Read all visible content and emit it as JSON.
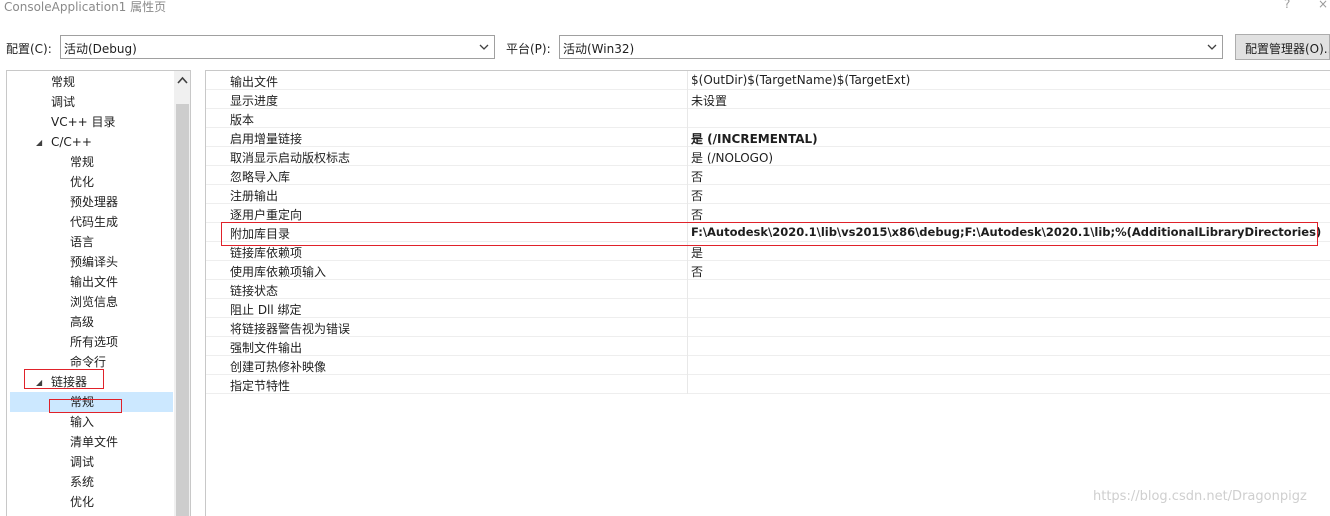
{
  "window": {
    "title": "ConsoleApplication1 属性页",
    "help_glyph": "?",
    "close_glyph": "×"
  },
  "toolbar": {
    "config_label": "配置(C):",
    "config_value": "活动(Debug)",
    "platform_label": "平台(P):",
    "platform_value": "活动(Win32)",
    "config_manager_label": "配置管理器(O)..."
  },
  "tree": {
    "items": [
      {
        "label": "常规",
        "level": 1
      },
      {
        "label": "调试",
        "level": 1
      },
      {
        "label": "VC++ 目录",
        "level": 1
      },
      {
        "label": "C/C++",
        "level": 1,
        "expanded": true
      },
      {
        "label": "常规",
        "level": 2
      },
      {
        "label": "优化",
        "level": 2
      },
      {
        "label": "预处理器",
        "level": 2
      },
      {
        "label": "代码生成",
        "level": 2
      },
      {
        "label": "语言",
        "level": 2
      },
      {
        "label": "预编译头",
        "level": 2
      },
      {
        "label": "输出文件",
        "level": 2
      },
      {
        "label": "浏览信息",
        "level": 2
      },
      {
        "label": "高级",
        "level": 2
      },
      {
        "label": "所有选项",
        "level": 2
      },
      {
        "label": "命令行",
        "level": 2
      },
      {
        "label": "链接器",
        "level": 1,
        "expanded": true
      },
      {
        "label": "常规",
        "level": 2,
        "selected": true
      },
      {
        "label": "输入",
        "level": 2
      },
      {
        "label": "清单文件",
        "level": 2
      },
      {
        "label": "调试",
        "level": 2
      },
      {
        "label": "系统",
        "level": 2
      },
      {
        "label": "优化",
        "level": 2
      }
    ]
  },
  "properties": {
    "rows": [
      {
        "name": "输出文件",
        "value": "$(OutDir)$(TargetName)$(TargetExt)",
        "bold": false
      },
      {
        "name": "显示进度",
        "value": "未设置",
        "bold": false
      },
      {
        "name": "版本",
        "value": "",
        "bold": false
      },
      {
        "name": "启用增量链接",
        "value": "是 (/INCREMENTAL)",
        "bold": true
      },
      {
        "name": "取消显示启动版权标志",
        "value": "是 (/NOLOGO)",
        "bold": false
      },
      {
        "name": "忽略导入库",
        "value": "否",
        "bold": false
      },
      {
        "name": "注册输出",
        "value": "否",
        "bold": false
      },
      {
        "name": "逐用户重定向",
        "value": "否",
        "bold": false
      },
      {
        "name": "附加库目录",
        "value": "F:\\Autodesk\\2020.1\\lib\\vs2015\\x86\\debug;F:\\Autodesk\\2020.1\\lib;%(AdditionalLibraryDirectories)",
        "bold": true
      },
      {
        "name": "链接库依赖项",
        "value": "是",
        "bold": false
      },
      {
        "name": "使用库依赖项输入",
        "value": "否",
        "bold": false
      },
      {
        "name": "链接状态",
        "value": "",
        "bold": false
      },
      {
        "name": "阻止 Dll 绑定",
        "value": "",
        "bold": false
      },
      {
        "name": "将链接器警告视为错误",
        "value": "",
        "bold": false
      },
      {
        "name": "强制文件输出",
        "value": "",
        "bold": false
      },
      {
        "name": "创建可热修补映像",
        "value": "",
        "bold": false
      },
      {
        "name": "指定节特性",
        "value": "",
        "bold": false
      }
    ]
  },
  "watermark": "https://blog.csdn.net/Dragonpigz",
  "colors": {
    "annotation_red": "#e0222a",
    "selection_blue": "#cce8ff"
  }
}
